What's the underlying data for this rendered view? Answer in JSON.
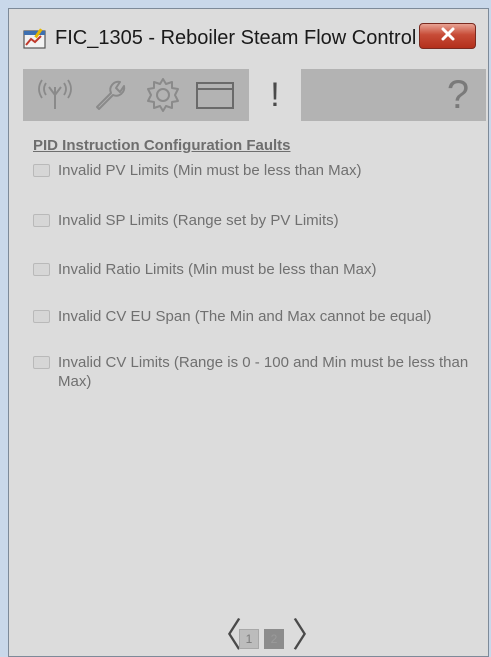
{
  "window": {
    "title": "FIC_1305 - Reboiler Steam Flow Control",
    "close_icon": "close-icon"
  },
  "tabs": [
    {
      "icon": "signal-icon",
      "active": false
    },
    {
      "icon": "wrench-icon",
      "active": false
    },
    {
      "icon": "gear-icon",
      "active": false
    },
    {
      "icon": "window-icon",
      "active": false
    },
    {
      "label": "!",
      "icon": "alarm-icon",
      "active": true
    },
    {
      "label": "?",
      "icon": "help-icon",
      "active": false
    }
  ],
  "content": {
    "section_title": "PID Instruction Configuration Faults",
    "faults": [
      {
        "label": "Invalid PV Limits (Min must be less than Max)",
        "checked": false
      },
      {
        "label": "Invalid SP Limits (Range set by PV Limits)",
        "checked": false
      },
      {
        "label": "Invalid Ratio Limits (Min must be less than Max)",
        "checked": false
      },
      {
        "label": "Invalid CV EU Span (The Min and Max cannot be equal)",
        "checked": false
      },
      {
        "label": "Invalid CV Limits (Range is 0 - 100 and Min must be less than Max)",
        "checked": false
      }
    ]
  },
  "pager": {
    "prev": "〈",
    "next": "〉",
    "pages": [
      "1",
      "2"
    ],
    "current": "2"
  },
  "colors": {
    "background": "#dcdcdc",
    "tabstrip": "#b3b3b3",
    "close_button": "#c74b37",
    "muted_text": "#707070"
  }
}
